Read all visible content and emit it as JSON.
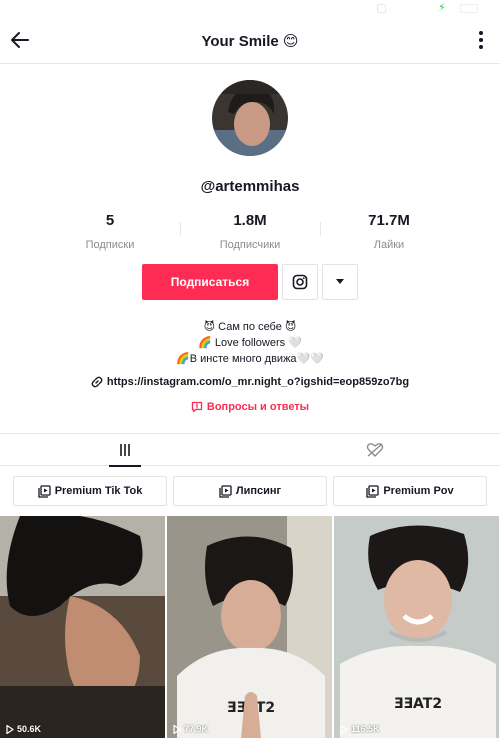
{
  "header": {
    "title": "Your Smile 😊"
  },
  "profile": {
    "username": "@artemmihas",
    "stats": [
      {
        "value": "5",
        "label": "Подписки"
      },
      {
        "value": "1.8M",
        "label": "Подписчики"
      },
      {
        "value": "71.7M",
        "label": "Лайки"
      }
    ],
    "follow_label": "Подписаться",
    "bio": [
      "😈 Сам по себе 😈",
      "🌈 Love followers 🤍",
      "🌈В инсте много движа🤍🤍"
    ],
    "link": "https://instagram.com/o_mr.night_o?igshid=eop859zo7bg",
    "qa_label": "Вопросы и ответы"
  },
  "tabs": [
    {
      "icon": "grid-icon",
      "active": true
    },
    {
      "icon": "liked-hidden-icon",
      "active": false
    }
  ],
  "playlists": [
    {
      "label": "Premium Tik Tok",
      "icon": "playlist-icon"
    },
    {
      "label": "Липсинг",
      "icon": "playlist-icon"
    },
    {
      "label": "Premium Pov",
      "icon": "playlist-icon"
    }
  ],
  "videos": [
    {
      "views": "50.6K"
    },
    {
      "views": "77.9K"
    },
    {
      "views": "116.5K"
    }
  ],
  "colors": {
    "accent": "#fe2c55",
    "text": "#161823",
    "muted": "#8a8b91",
    "border": "#e6e6e8"
  }
}
